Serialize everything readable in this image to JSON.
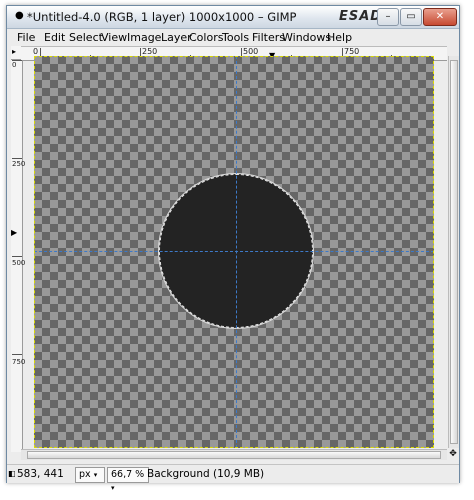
{
  "window": {
    "title": "*Untitled-4.0 (RGB, 1 layer) 1000x1000 – GIMP",
    "brand": "ESAD",
    "buttons": {
      "minimize": "–",
      "maximize": "▭",
      "close": "✕"
    }
  },
  "menubar": {
    "items": [
      {
        "label": "File"
      },
      {
        "label": "Edit"
      },
      {
        "label": "Select"
      },
      {
        "label": "View"
      },
      {
        "label": "Image"
      },
      {
        "label": "Layer"
      },
      {
        "label": "Colors"
      },
      {
        "label": "Tools"
      },
      {
        "label": "Filters"
      },
      {
        "label": "Windows"
      },
      {
        "label": "Help"
      }
    ]
  },
  "ruler": {
    "horizontal_labels": [
      "0",
      "250",
      "500",
      "750"
    ],
    "vertical_labels": [
      "0",
      "250",
      "500",
      "750"
    ]
  },
  "statusbar": {
    "coordinates": "583, 441",
    "unit": "px",
    "zoom": "66,7 %",
    "message": "Background (10,9 MB)"
  },
  "icons": {
    "nav": "navigate-icon",
    "quickmask": "quickmask-icon"
  }
}
